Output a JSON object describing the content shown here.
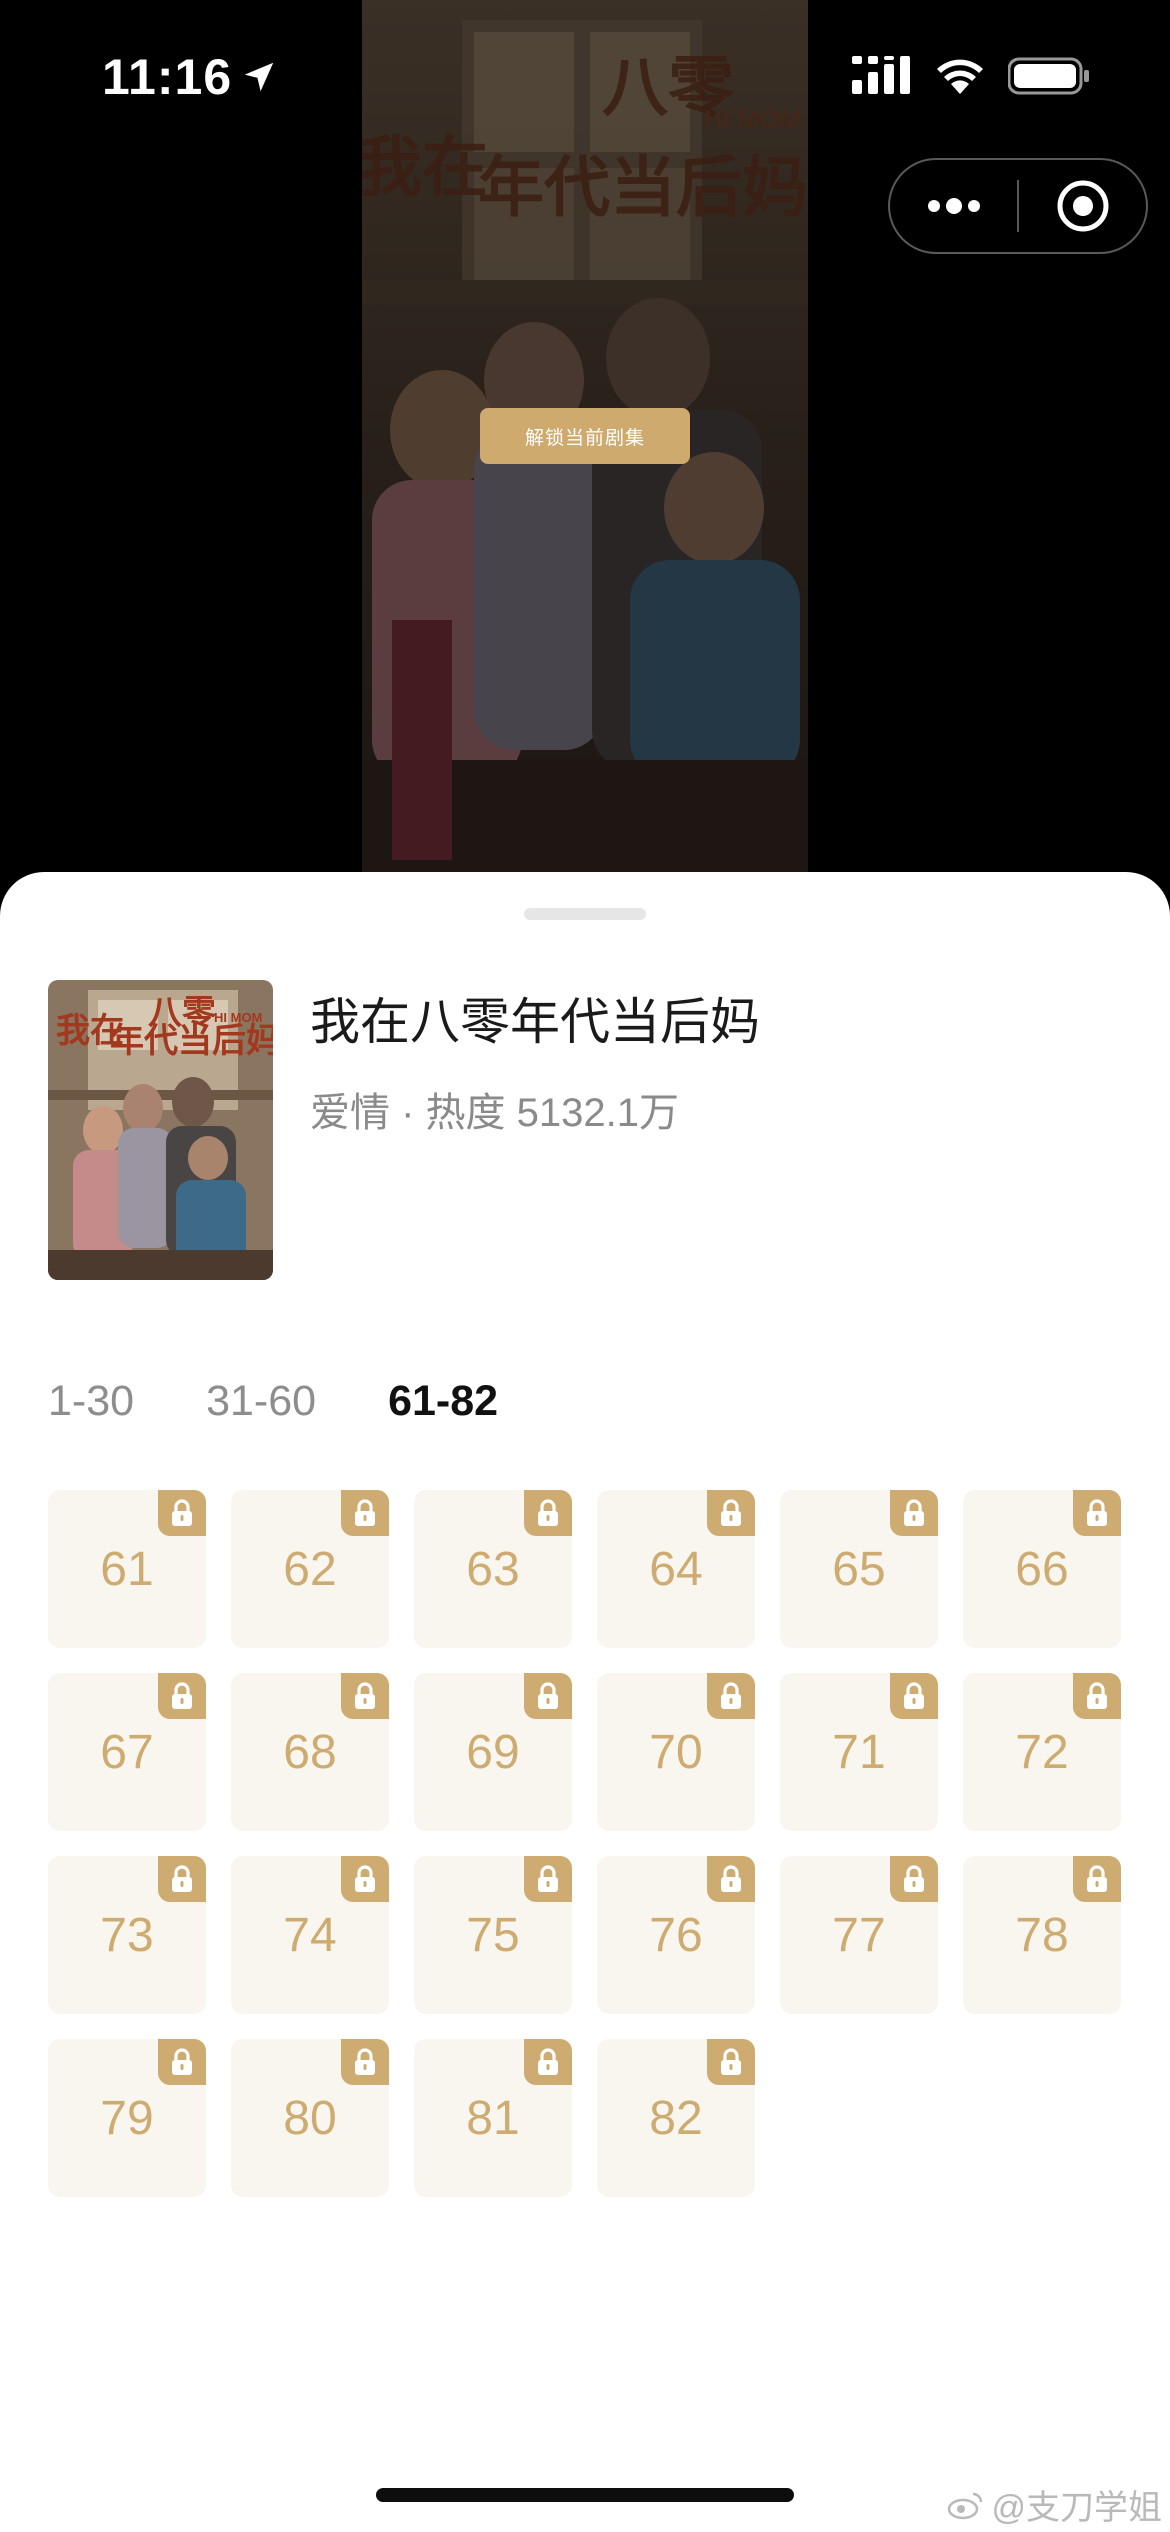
{
  "status_bar": {
    "time": "11:16",
    "icons": [
      "location-arrow-icon",
      "signal-icon",
      "wifi-icon",
      "battery-icon"
    ]
  },
  "capsule": {
    "icons": [
      "more-icon",
      "close-target-icon"
    ]
  },
  "video": {
    "poster_title_line1": "八零",
    "poster_title_line2": "我在",
    "poster_title_line3": "年代当后妈",
    "poster_subtitle": "HI MOM",
    "unlock_label": "解锁当前剧集"
  },
  "drama": {
    "title": "我在八零年代当后妈",
    "meta": "爱情 · 热度 5132.1万"
  },
  "range_tabs": [
    {
      "label": "1-30",
      "active": false
    },
    {
      "label": "31-60",
      "active": false
    },
    {
      "label": "61-82",
      "active": true
    }
  ],
  "episodes": [
    "61",
    "62",
    "63",
    "64",
    "65",
    "66",
    "67",
    "68",
    "69",
    "70",
    "71",
    "72",
    "73",
    "74",
    "75",
    "76",
    "77",
    "78",
    "79",
    "80",
    "81",
    "82"
  ],
  "episode_locked": true,
  "watermark": "@支刀学姐",
  "colors": {
    "accent_gold": "#cdab71",
    "tile_bg": "#f9f6ef",
    "unlock_button": "#cfaa6e"
  }
}
